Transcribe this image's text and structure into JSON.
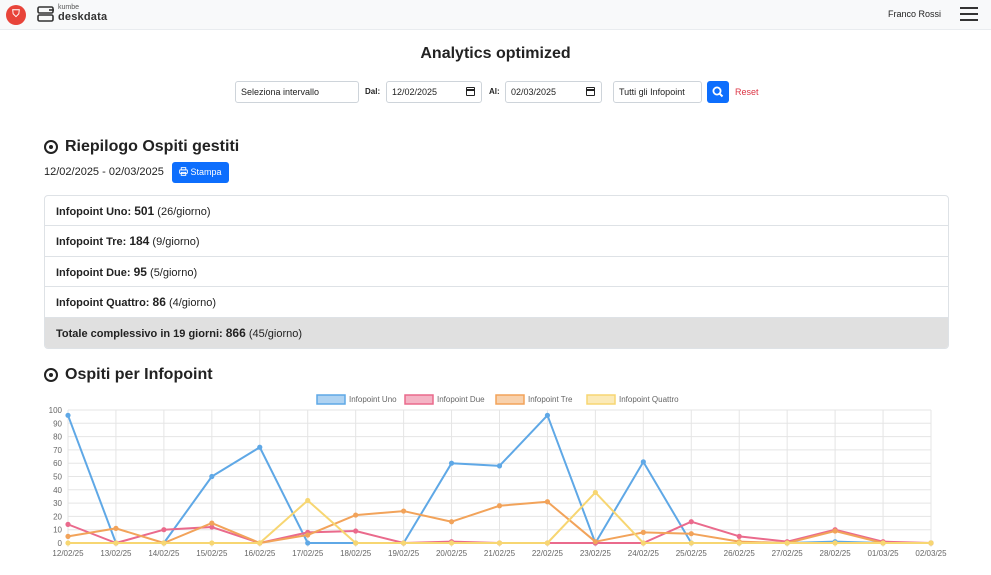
{
  "navbar": {
    "brand_small": "kumbe",
    "brand_name": "deskdata",
    "user_name": "Franco Rossi"
  },
  "page_title": "Analytics optimized",
  "filters": {
    "range_select": "Seleziona intervallo",
    "from_label": "Dal:",
    "from_date": "12/02/2025",
    "to_label": "Al:",
    "to_date": "02/03/2025",
    "infopoint_select": "Tutti gli Infopoint",
    "reset_label": "Reset"
  },
  "summary": {
    "title": "Riepilogo Ospiti gestiti",
    "range": "12/02/2025 - 02/03/2025",
    "print_label": "Stampa",
    "rows": [
      {
        "label": "Infopoint Uno:",
        "value": "501",
        "rate": "(26/giorno)"
      },
      {
        "label": "Infopoint Tre:",
        "value": "184",
        "rate": "(9/giorno)"
      },
      {
        "label": "Infopoint Due:",
        "value": "95",
        "rate": "(5/giorno)"
      },
      {
        "label": "Infopoint Quattro:",
        "value": "86",
        "rate": "(4/giorno)"
      },
      {
        "label": "Totale complessivo in 19 giorni:",
        "value": "866",
        "rate": "(45/giorno)"
      }
    ]
  },
  "chart_section": {
    "title": "Ospiti per Infopoint"
  },
  "chart_data": {
    "type": "line",
    "categories": [
      "12/02/25",
      "13/02/25",
      "14/02/25",
      "15/02/25",
      "16/02/25",
      "17/02/25",
      "18/02/25",
      "19/02/25",
      "20/02/25",
      "21/02/25",
      "22/02/25",
      "23/02/25",
      "24/02/25",
      "25/02/25",
      "26/02/25",
      "27/02/25",
      "28/02/25",
      "01/03/25",
      "02/03/25"
    ],
    "ylim": [
      0,
      100
    ],
    "yticks": [
      0,
      10,
      20,
      30,
      40,
      50,
      60,
      70,
      80,
      90,
      100
    ],
    "grid": true,
    "legend_position": "top",
    "series": [
      {
        "name": "Infopoint Uno",
        "color": "#5fa8e6",
        "values": [
          96,
          0,
          0,
          50,
          72,
          0,
          0,
          0,
          60,
          58,
          96,
          0,
          61,
          0,
          0,
          0,
          1,
          0,
          0
        ]
      },
      {
        "name": "Infopoint Due",
        "color": "#ea6a8c",
        "values": [
          14,
          0,
          10,
          12,
          0,
          8,
          9,
          0,
          1,
          0,
          0,
          0,
          0,
          16,
          5,
          1,
          10,
          1,
          0
        ]
      },
      {
        "name": "Infopoint Tre",
        "color": "#f2a35a",
        "values": [
          5,
          11,
          0,
          15,
          0,
          6,
          21,
          24,
          16,
          28,
          31,
          1,
          8,
          7,
          1,
          0,
          9,
          0,
          0
        ]
      },
      {
        "name": "Infopoint Quattro",
        "color": "#f7d672",
        "values": [
          0,
          0,
          0,
          0,
          0,
          32,
          0,
          0,
          0,
          0,
          0,
          38,
          0,
          0,
          0,
          0,
          0,
          0,
          0
        ]
      }
    ]
  }
}
